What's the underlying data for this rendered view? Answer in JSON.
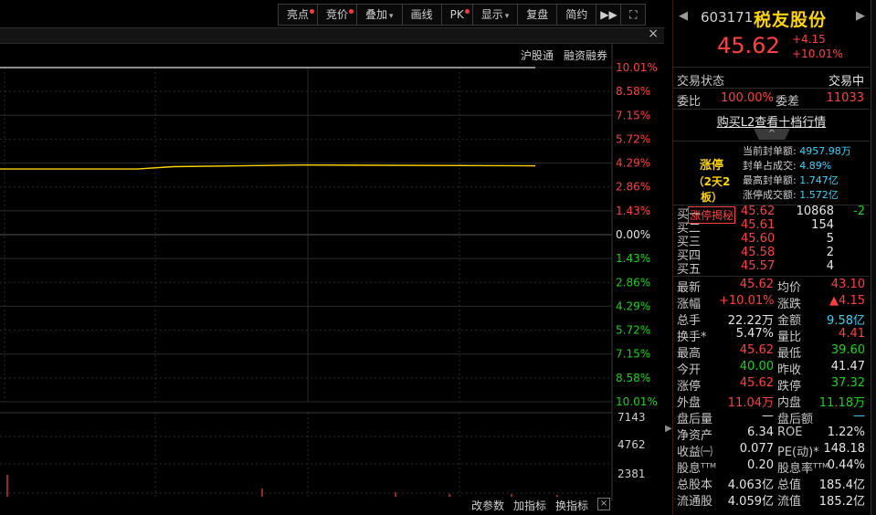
{
  "toolbar": {
    "buttons": [
      {
        "label": "亮点",
        "dot": true
      },
      {
        "label": "竞价",
        "dot": true
      },
      {
        "label": "叠加",
        "caret": "▾"
      },
      {
        "label": "画线"
      },
      {
        "label": "PK",
        "dot": true
      },
      {
        "label": "显示",
        "caret": "▾"
      },
      {
        "label": "复盘"
      },
      {
        "label": "简约"
      },
      {
        "label": "▶▶",
        "icon": "fast-forward-icon"
      },
      {
        "label": "⛶",
        "icon": "fullscreen-icon"
      }
    ]
  },
  "chart_header": {
    "close": "×"
  },
  "chart_links": {
    "hkconnect": "沪股通",
    "margin": "融资融券"
  },
  "chart_data": {
    "type": "line",
    "series": [
      {
        "values": [
          43.1,
          43.1,
          43.16,
          43.2,
          43.18
        ]
      }
    ],
    "pct_axis_labels": [
      "10.01%",
      "8.58%",
      "7.15%",
      "5.72%",
      "4.29%",
      "2.86%",
      "1.43%",
      "0.00%",
      "1.43%",
      "2.86%",
      "4.29%",
      "5.72%",
      "7.15%",
      "8.58%",
      "10.01%"
    ],
    "pct_axis_colors": [
      "red",
      "red",
      "red",
      "red",
      "red",
      "red",
      "red",
      "white",
      "green",
      "green",
      "green",
      "green",
      "green",
      "green",
      "green"
    ],
    "volume_axis_labels": [
      "7143",
      "4762",
      "2381"
    ],
    "ylim": [
      37.32,
      45.62
    ],
    "grid": true
  },
  "bottom_bar": {
    "params": "改参数",
    "add_ind": "加指标",
    "switch_ind": "换指标",
    "close": "×"
  },
  "side_arrow": "▶",
  "quote": {
    "code": "603171",
    "name": "税友股份",
    "nav_left": "◀",
    "nav_right": "▶",
    "price": "45.62",
    "change": "+4.15",
    "change_pct": "+10.01%",
    "status_label": "交易状态",
    "status_value": "交易中",
    "ratio_label": "委比",
    "ratio_value": "100.00%",
    "diff_label": "委差",
    "diff_value": "11033",
    "l2_link": "购买L2查看十档行情",
    "collapse": "^",
    "limit": {
      "title": "涨停",
      "days": "（2天2板）",
      "secret_btn": "涨停揭秘"
    },
    "seal": [
      {
        "label": "当前封单额:",
        "value": "4957.98万"
      },
      {
        "label": "封单占成交:",
        "value": "4.89%"
      },
      {
        "label": "最高封单额:",
        "value": "1.747亿"
      },
      {
        "label": "涨停成交额:",
        "value": "1.572亿"
      }
    ],
    "bids": [
      {
        "name": "买一",
        "price": "45.62",
        "vol": "10868",
        "chg": "-2"
      },
      {
        "name": "买二",
        "price": "45.61",
        "vol": "154",
        "chg": ""
      },
      {
        "name": "买三",
        "price": "45.60",
        "vol": "5",
        "chg": ""
      },
      {
        "name": "买四",
        "price": "45.58",
        "vol": "2",
        "chg": ""
      },
      {
        "name": "买五",
        "price": "45.57",
        "vol": "4",
        "chg": ""
      }
    ],
    "stats": [
      {
        "k1": "最新",
        "v1": "45.62",
        "c1": "red",
        "k2": "均价",
        "v2": "43.10",
        "c2": "red"
      },
      {
        "k1": "涨幅",
        "v1": "+10.01%",
        "c1": "red",
        "k2": "涨跌",
        "v2": "▲4.15",
        "c2": "red"
      },
      {
        "k1": "总手",
        "v1": "22.22万",
        "c1": "white",
        "k2": "金额",
        "v2": "9.58亿",
        "c2": "cyan"
      },
      {
        "k1": "换手*",
        "v1": "5.47%",
        "c1": "white",
        "k2": "量比",
        "v2": "4.41",
        "c2": "red"
      },
      {
        "k1": "最高",
        "v1": "45.62",
        "c1": "red",
        "k2": "最低",
        "v2": "39.60",
        "c2": "green"
      },
      {
        "k1": "今开",
        "v1": "40.00",
        "c1": "green",
        "k2": "昨收",
        "v2": "41.47",
        "c2": "white"
      },
      {
        "k1": "涨停",
        "v1": "45.62",
        "c1": "red",
        "k2": "跌停",
        "v2": "37.32",
        "c2": "green"
      },
      {
        "k1": "外盘",
        "v1": "11.04万",
        "c1": "red",
        "k2": "内盘",
        "v2": "11.18万",
        "c2": "green"
      },
      {
        "k1": "盘后量",
        "v1": "—",
        "c1": "white",
        "k2": "盘后额",
        "v2": "—",
        "c2": "cyan"
      },
      {
        "k1": "净资产",
        "v1": "6.34",
        "c1": "white",
        "k2": "ROE",
        "v2": "1.22%",
        "c2": "white"
      },
      {
        "k1": "收益㈠",
        "v1": "0.077",
        "c1": "white",
        "k2": "PE(动)*",
        "v2": "148.18",
        "c2": "white"
      },
      {
        "k1": "股息ᵀᵀᴹ",
        "v1": "0.20",
        "c1": "white",
        "k2": "股息率ᵀᵀᴹ",
        "v2": "0.44%",
        "c2": "white"
      },
      {
        "k1": "总股本",
        "v1": "4.063亿",
        "c1": "white",
        "k2": "总值",
        "v2": "185.4亿",
        "c2": "white"
      },
      {
        "k1": "流通股",
        "v1": "4.059亿",
        "c1": "white",
        "k2": "流值",
        "v2": "185.2亿",
        "c2": "white"
      }
    ]
  },
  "colors": {
    "red": "#ff4040",
    "green": "#19d219",
    "cyan": "#33d6ff",
    "yellow": "#ffd400",
    "white": "#e6e6e6"
  }
}
